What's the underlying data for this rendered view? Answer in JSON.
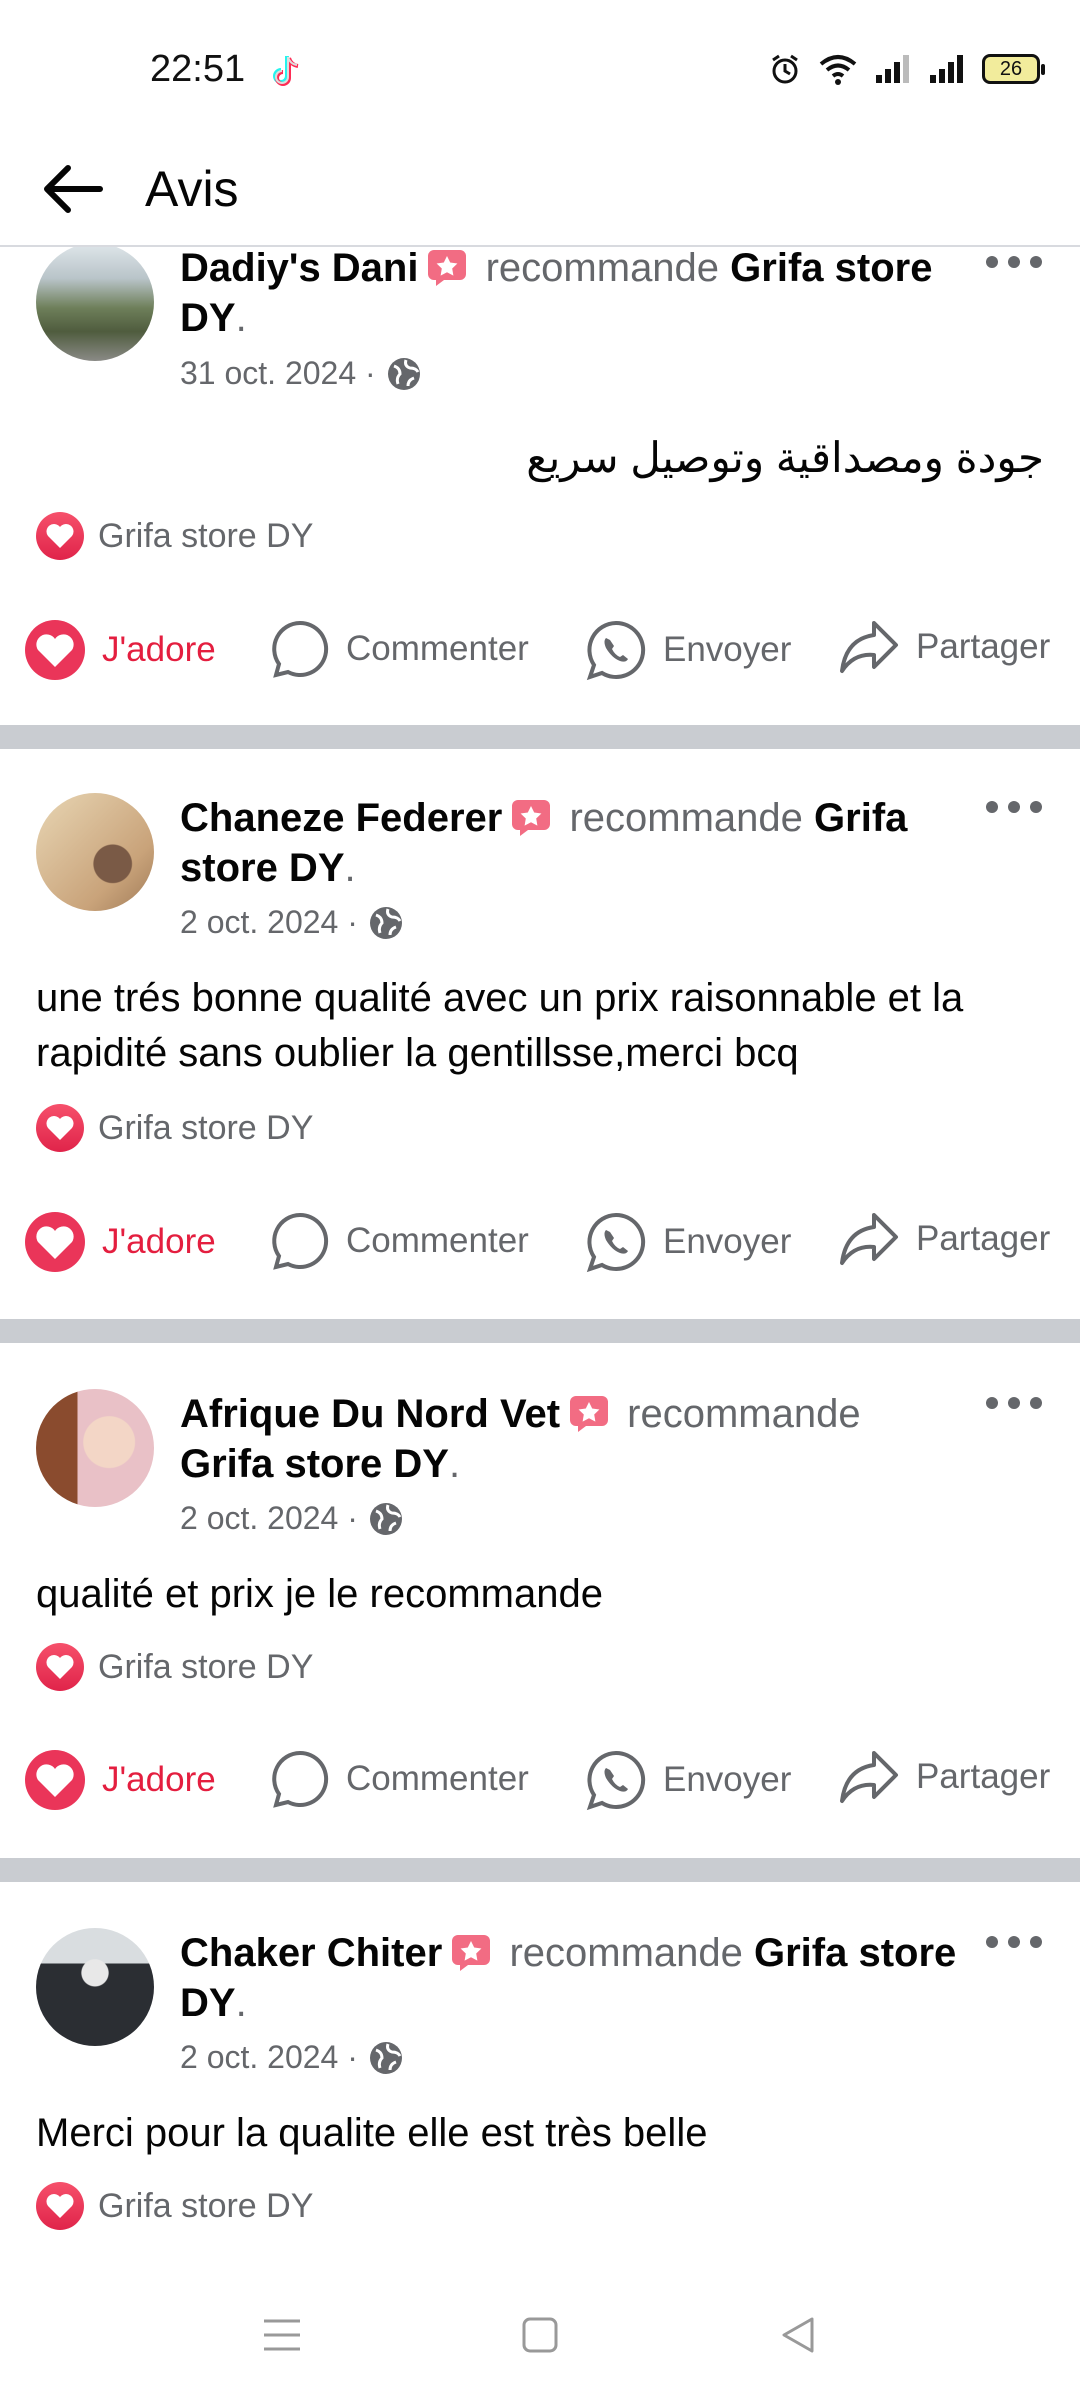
{
  "status": {
    "time": "22:51",
    "battery": "26"
  },
  "header": {
    "title": "Avis"
  },
  "posts": [
    {
      "author": "Dadiy's Dani",
      "verb": "recommande",
      "page": "Grifa store DY",
      "date": "31 oct. 2024 ·",
      "text": "جودة ومصداقية وتوصيل سريع",
      "reaction_by": "Grifa store DY"
    },
    {
      "author": "Chaneze Federer",
      "verb": "recommande",
      "page": "Grifa store DY",
      "date": "2 oct. 2024 ·",
      "text": "une trés bonne qualité avec un prix raisonnable et la rapidité sans oublier la gentillsse,merci bcq",
      "reaction_by": "Grifa store DY"
    },
    {
      "author": "Afrique Du Nord Vet",
      "verb": "recommande",
      "page": "Grifa store DY",
      "date": "2 oct. 2024 ·",
      "text": "qualité et prix je le recommande",
      "reaction_by": "Grifa store DY"
    },
    {
      "author": "Chaker Chiter",
      "verb": "recommande",
      "page": "Grifa store DY",
      "date": "2 oct. 2024 ·",
      "text": "Merci pour la qualite elle est très belle",
      "reaction_by": "Grifa store DY"
    }
  ],
  "actions": {
    "love": "J'adore",
    "comment": "Commenter",
    "send": "Envoyer",
    "share": "Partager"
  },
  "icons": [
    "back-arrow-icon",
    "star-badge-icon",
    "globe-icon",
    "more-icon",
    "heart-icon",
    "comment-icon",
    "whatsapp-icon",
    "share-icon",
    "menu-icon",
    "home-square-icon",
    "back-triangle-icon"
  ],
  "colors": {
    "love": "#e41e3f",
    "secondary": "#65676b",
    "divider": "#c9ccd1"
  }
}
